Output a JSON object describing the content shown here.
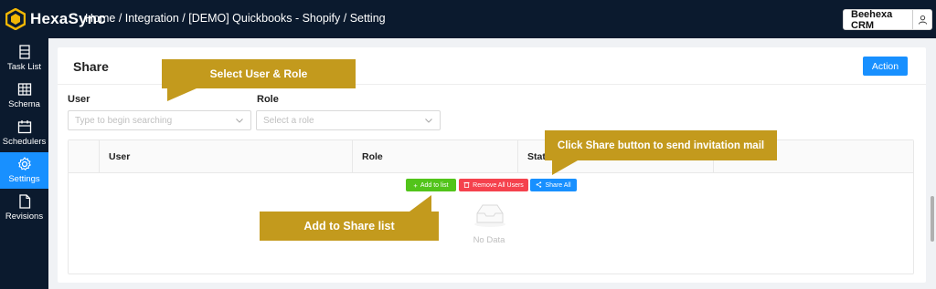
{
  "app": {
    "name": "HexaSync"
  },
  "breadcrumb": "Home / Integration / [DEMO] Quickbooks - Shopify / Setting",
  "account": {
    "name": "Beehexa CRM"
  },
  "sidebar": {
    "items": [
      {
        "label": "Task List",
        "icon": "task-list-icon"
      },
      {
        "label": "Schema",
        "icon": "table-icon"
      },
      {
        "label": "Schedulers",
        "icon": "calendar-icon"
      },
      {
        "label": "Settings",
        "icon": "gear-icon",
        "active": true
      },
      {
        "label": "Revisions",
        "icon": "file-icon"
      }
    ]
  },
  "card": {
    "title": "Share",
    "action_label": "Action",
    "user": {
      "label": "User",
      "placeholder": "Type to begin searching"
    },
    "role": {
      "label": "Role",
      "placeholder": "Select a role"
    },
    "table": {
      "columns": [
        "User",
        "Role",
        "Stat"
      ],
      "buttons": {
        "add": "Add to list",
        "remove": "Remove All Users",
        "share": "Share All"
      },
      "empty_text": "No Data"
    }
  },
  "callouts": {
    "select": "Select User & Role",
    "share": "Click Share button to send invitation mail",
    "add": "Add to Share list"
  },
  "colors": {
    "topbar": "#0b1a2e",
    "primary": "#1890ff",
    "success": "#52c41a",
    "danger": "#f5424d",
    "callout": "#c39a1d"
  }
}
